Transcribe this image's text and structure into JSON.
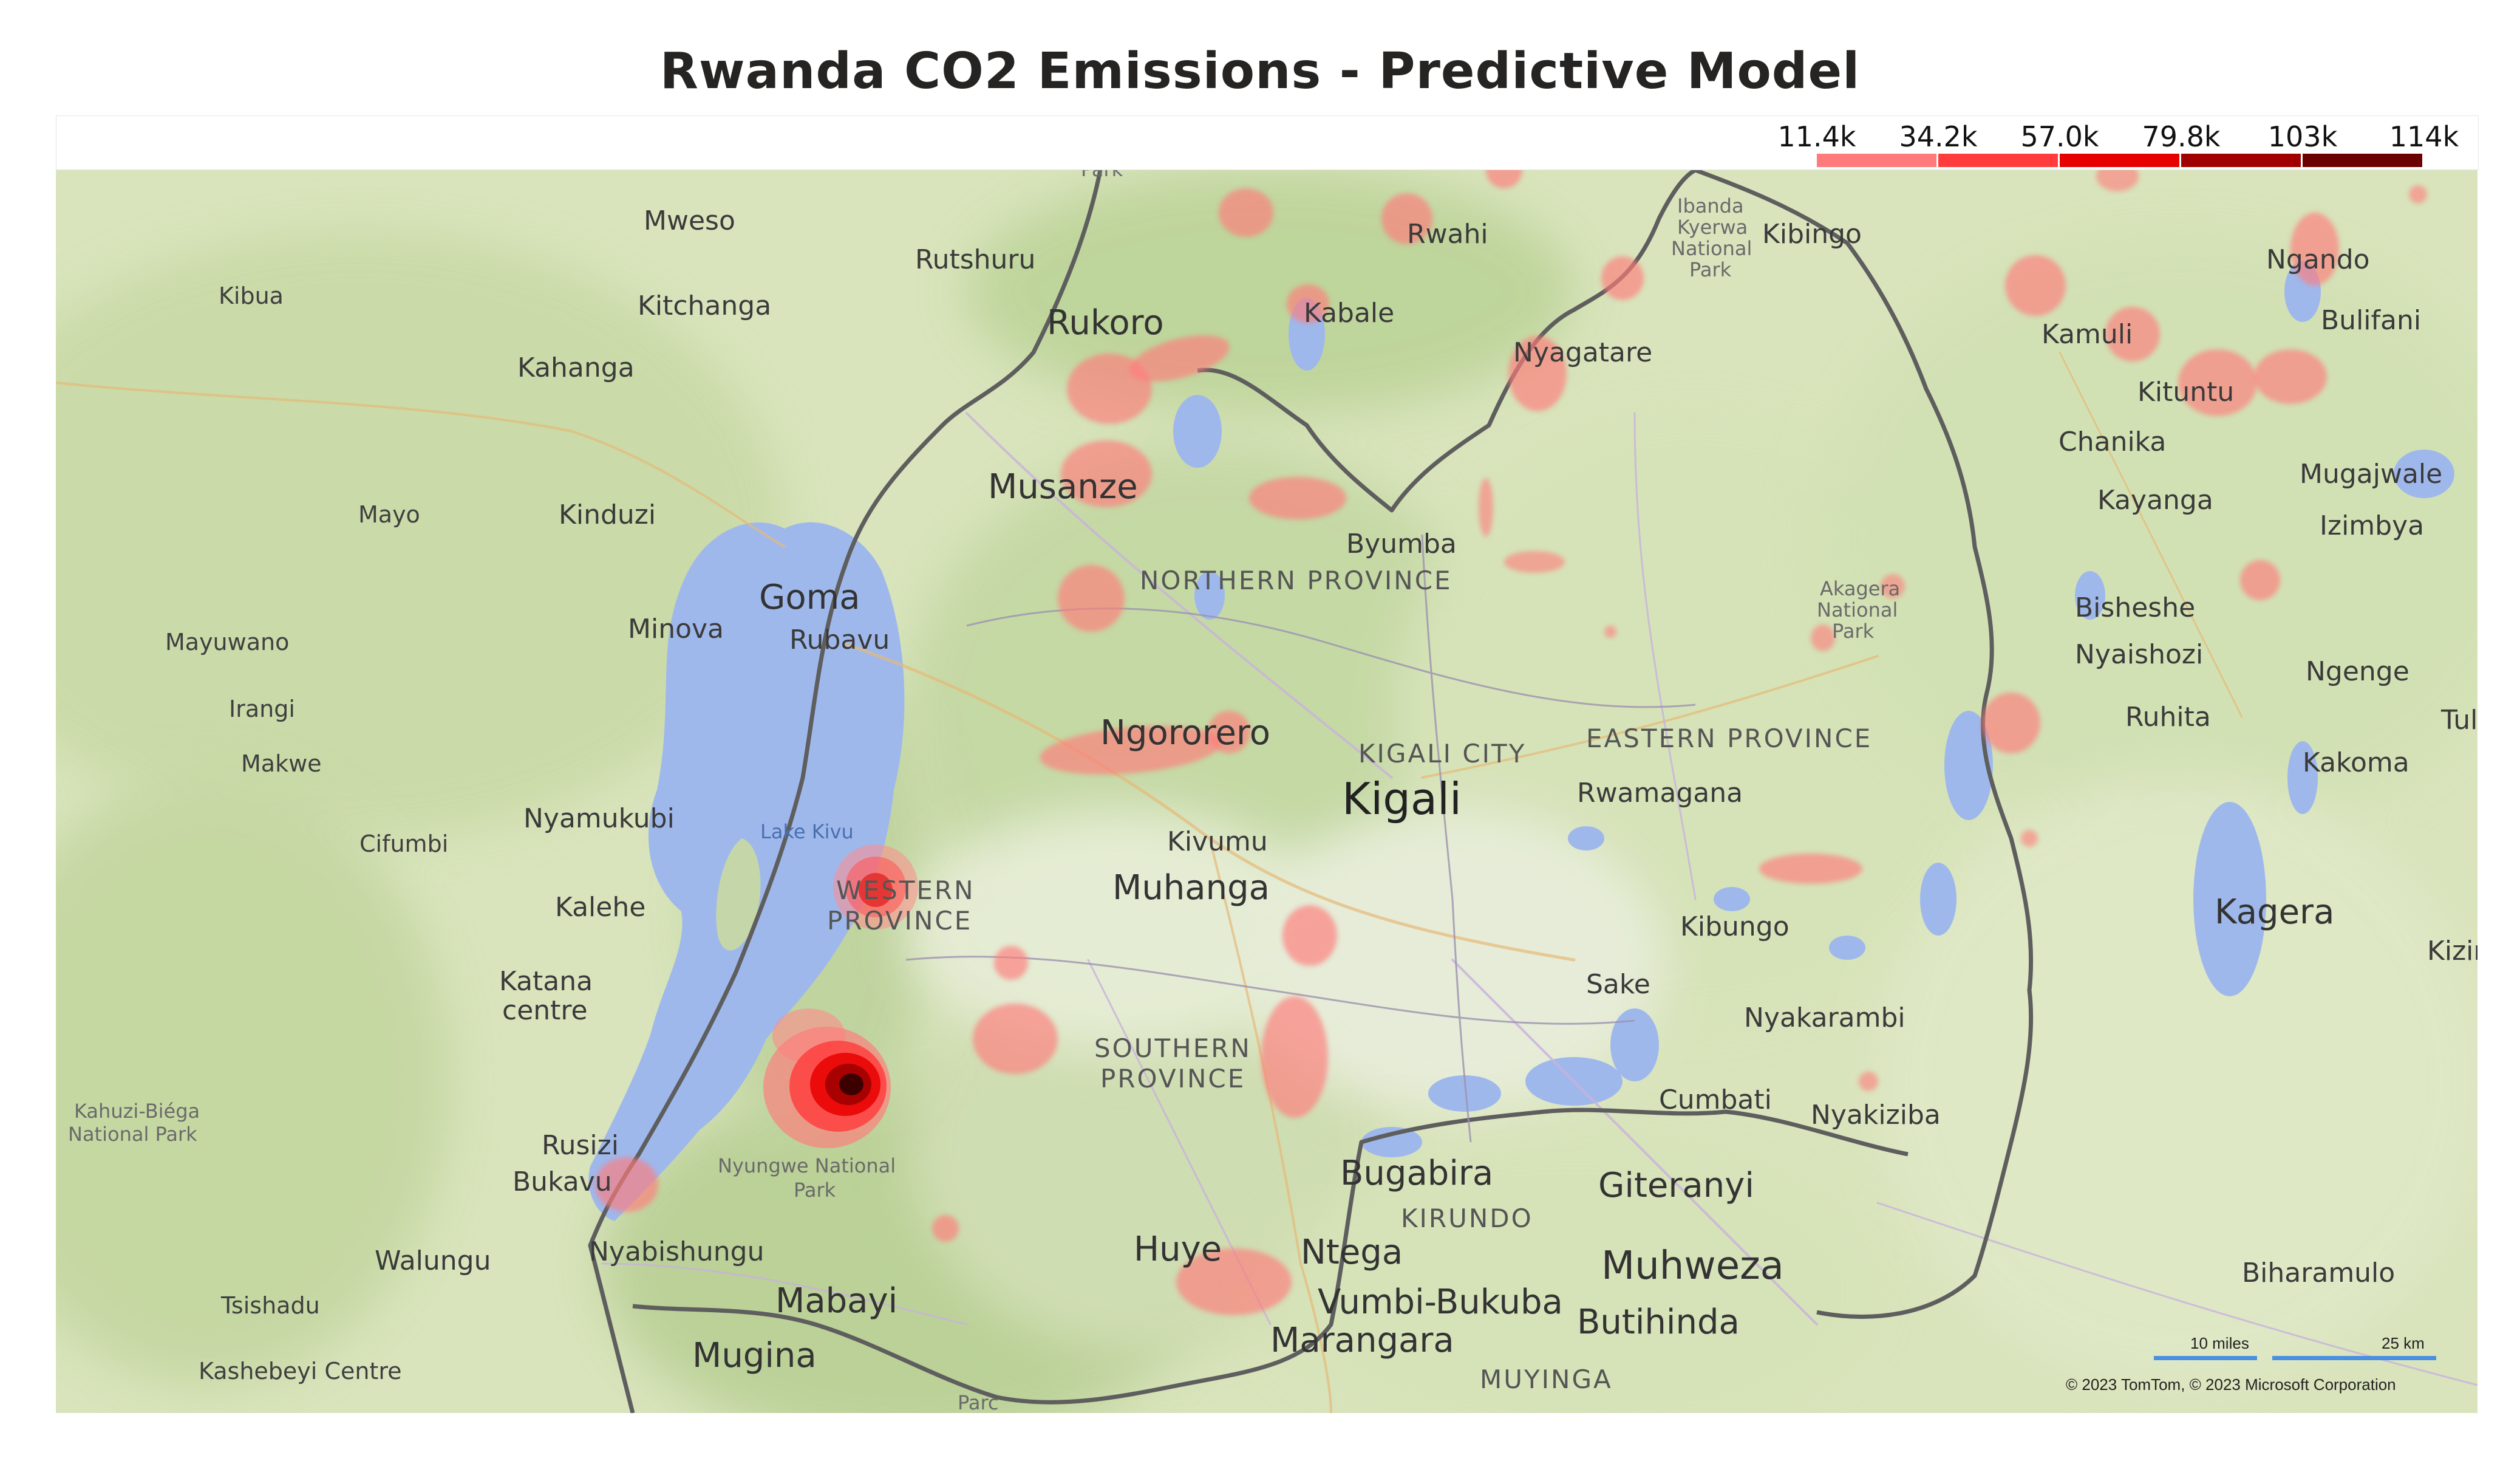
{
  "title": "Rwanda CO2 Emissions - Predictive Model",
  "legend": {
    "labels": [
      "11.4k",
      "34.2k",
      "57.0k",
      "79.8k",
      "103k",
      "114k"
    ],
    "colors": [
      "#ff7b7b",
      "#ff3b3b",
      "#e60000",
      "#a00000",
      "#6b0000",
      "#3d0000"
    ]
  },
  "map": {
    "labels": {
      "mweso": "Mweso",
      "rutshuru": "Rutshuru",
      "rukoro": "Rukoro",
      "kibua": "Kibua",
      "kitchanga": "Kitchanga",
      "kahanga": "Kahanga",
      "mayo": "Mayo",
      "kinduzi": "Kinduzi",
      "mayuwano": "Mayuwano",
      "minova": "Minova",
      "goma": "Goma",
      "rubavu": "Rubavu",
      "irangi": "Irangi",
      "makwe": "Makwe",
      "cifumbi": "Cifumbi",
      "nyamukubi": "Nyamukubi",
      "kalehe": "Kalehe",
      "katana": "Katana",
      "centre": "centre",
      "kahuzi1": "Kahuzi-Biéga",
      "kahuzi2": "National Park",
      "rusizi": "Rusizi",
      "bukavu": "Bukavu",
      "walungu": "Walungu",
      "nyabishungu": "Nyabishungu",
      "tsishadu": "Tsishadu",
      "kashebeyi": "Kashebeyi Centre",
      "mabayi": "Mabayi",
      "mugina": "Mugina",
      "nyungwe1": "Nyungwe National",
      "nyungwe2": "Park",
      "lakekivu": "Lake Kivu",
      "western1": "WESTERN",
      "western2": "PROVINCE",
      "musanze": "Musanze",
      "northern": "NORTHERN PROVINCE",
      "byumba": "Byumba",
      "ngororero": "Ngororero",
      "kivumu": "Kivumu",
      "muhanga": "Muhanga",
      "southern1": "SOUTHERN",
      "southern2": "PROVINCE",
      "huye": "Huye",
      "kigalicity": "KIGALI CITY",
      "kigali": "Kigali",
      "rwahi": "Rwahi",
      "kabale": "Kabale",
      "nyagatare": "Nyagatare",
      "ibanda1": "Ibanda",
      "ibanda2": "Kyerwa",
      "ibanda3": "National",
      "ibanda4": "Park",
      "kibingo": "Kibingo",
      "eastern": "EASTERN PROVINCE",
      "rwamagana": "Rwamagana",
      "kibungo": "Kibungo",
      "sake": "Sake",
      "nyakarambi": "Nyakarambi",
      "cumbati": "Cumbati",
      "nyakiziba": "Nyakiziba",
      "bugabira": "Bugabira",
      "kirundo": "KIRUNDO",
      "ntega": "Ntega",
      "vumbi": "Vumbi-Bukuba",
      "marangara": "Marangara",
      "muyinga": "MUYINGA",
      "giteranyi": "Giteranyi",
      "muhweza": "Muhweza",
      "butihinda": "Butihinda",
      "akagera1": "Akagera",
      "akagera2": "National",
      "akagera3": "Park",
      "kamuli": "Kamuli",
      "ngando": "Ngando",
      "bulifani": "Bulifani",
      "kituntu": "Kituntu",
      "chanika": "Chanika",
      "kayanga": "Kayanga",
      "mugajwale": "Mugajwale",
      "izimbya": "Izimbya",
      "bisheshe": "Bisheshe",
      "nyaishozi": "Nyaishozi",
      "ngenge": "Ngenge",
      "ruhita": "Ruhita",
      "kakoma": "Kakoma",
      "tul": "Tul",
      "kagera": "Kagera",
      "kizira": "Kizira",
      "biharamulo": "Biharamulo",
      "parc": "Parc",
      "park_top": "Park"
    },
    "scale": {
      "miles": "10 miles",
      "km": "25 km"
    },
    "copyright": "© 2023 TomTom, © 2023 Microsoft Corporation"
  }
}
